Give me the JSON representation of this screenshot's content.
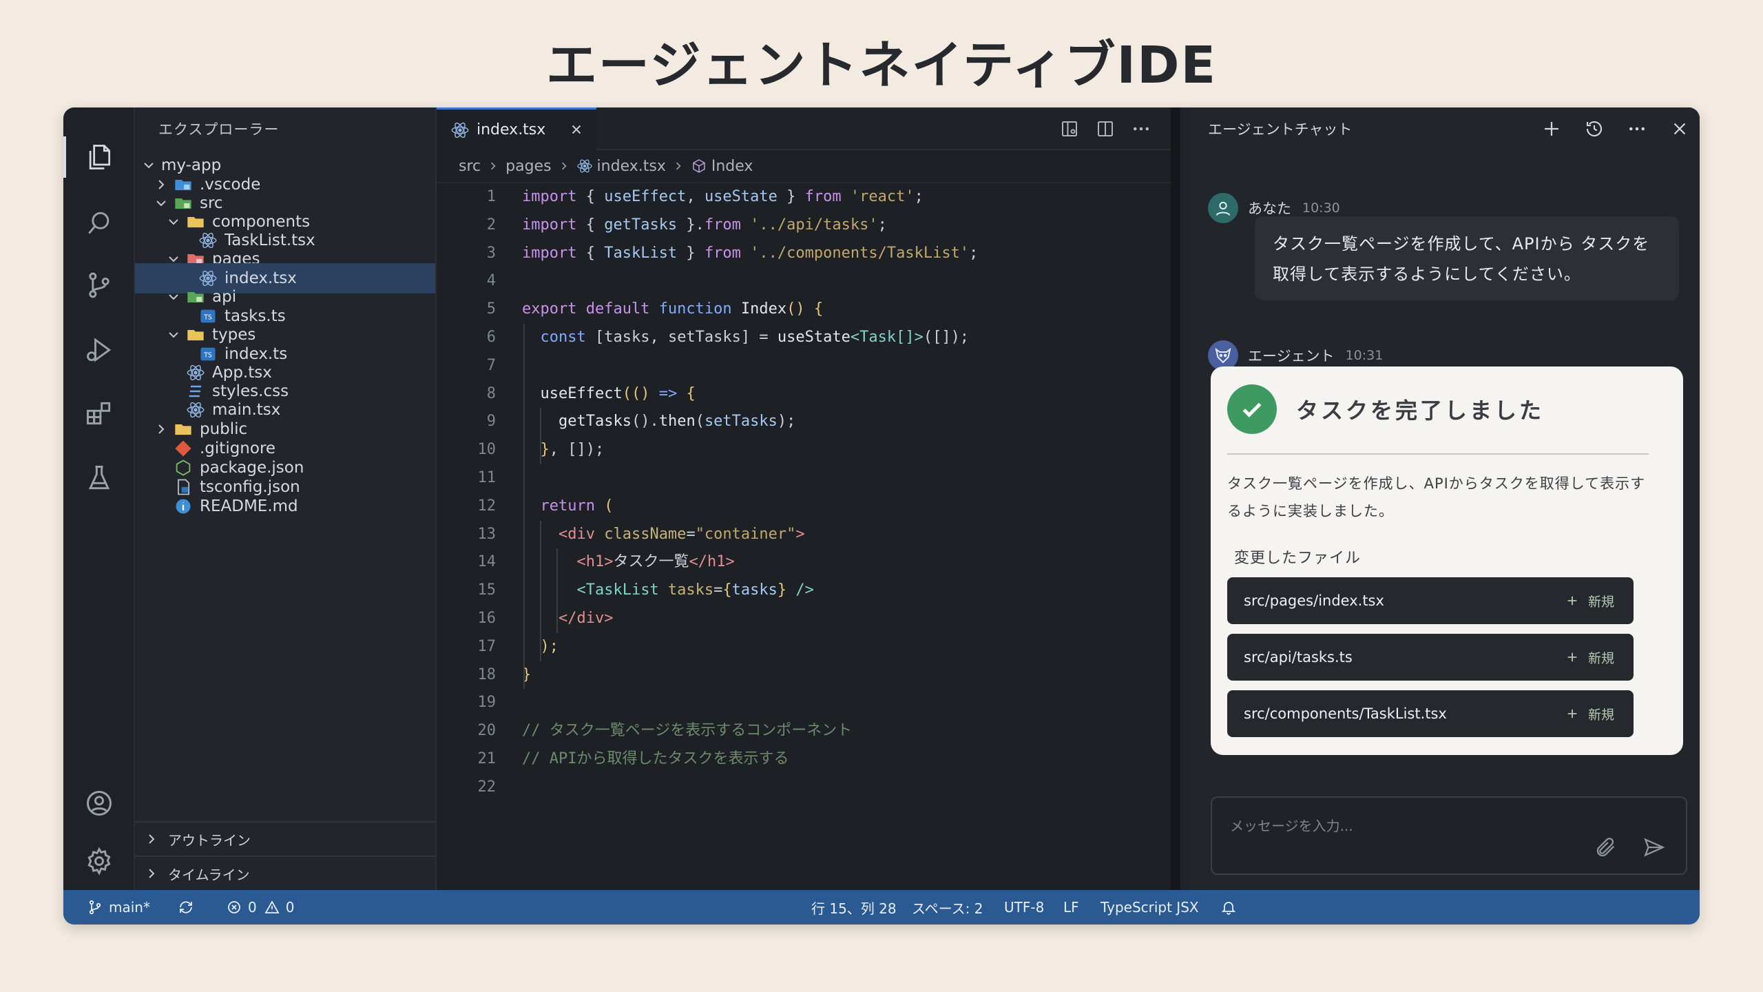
{
  "page": {
    "title": "エージェントネイティブIDE"
  },
  "explorer": {
    "header": "エクスプローラー",
    "tree": [
      {
        "label": "my-app",
        "depth": 0,
        "chevron": "down",
        "icon": "none"
      },
      {
        "label": ".vscode",
        "depth": 1,
        "chevron": "right",
        "icon": "folder-vscode"
      },
      {
        "label": "src",
        "depth": 1,
        "chevron": "down",
        "icon": "folder-src"
      },
      {
        "label": "components",
        "depth": 2,
        "chevron": "down",
        "icon": "folder"
      },
      {
        "label": "TaskList.tsx",
        "depth": 3,
        "chevron": "none",
        "icon": "react"
      },
      {
        "label": "pages",
        "depth": 2,
        "chevron": "down",
        "icon": "folder-pages"
      },
      {
        "label": "index.tsx",
        "depth": 3,
        "chevron": "none",
        "icon": "react",
        "selected": true
      },
      {
        "label": "api",
        "depth": 2,
        "chevron": "down",
        "icon": "folder-api"
      },
      {
        "label": "tasks.ts",
        "depth": 3,
        "chevron": "none",
        "icon": "ts"
      },
      {
        "label": "types",
        "depth": 2,
        "chevron": "down",
        "icon": "folder"
      },
      {
        "label": "index.ts",
        "depth": 3,
        "chevron": "none",
        "icon": "ts"
      },
      {
        "label": "App.tsx",
        "depth": 2,
        "chevron": "none",
        "icon": "react"
      },
      {
        "label": "styles.css",
        "depth": 2,
        "chevron": "none",
        "icon": "css"
      },
      {
        "label": "main.tsx",
        "depth": 2,
        "chevron": "none",
        "icon": "react"
      },
      {
        "label": "public",
        "depth": 1,
        "chevron": "right",
        "icon": "folder"
      },
      {
        "label": ".gitignore",
        "depth": 1,
        "chevron": "none",
        "icon": "git"
      },
      {
        "label": "package.json",
        "depth": 1,
        "chevron": "none",
        "icon": "node"
      },
      {
        "label": "tsconfig.json",
        "depth": 1,
        "chevron": "none",
        "icon": "tsconfig"
      },
      {
        "label": "README.md",
        "depth": 1,
        "chevron": "none",
        "icon": "info"
      }
    ],
    "sections": [
      "アウトライン",
      "タイムライン"
    ]
  },
  "editor": {
    "tab_label": "index.tsx",
    "breadcrumb": [
      "src",
      "pages",
      "index.tsx",
      "Index"
    ],
    "lines": [
      [
        [
          "k",
          "import "
        ],
        [
          "p",
          "{ "
        ],
        [
          "v",
          "useEffect"
        ],
        [
          "p",
          ", "
        ],
        [
          "v",
          "useState"
        ],
        [
          "p",
          " } "
        ],
        [
          "k",
          "from "
        ],
        [
          "s",
          "'react'"
        ],
        [
          "p",
          ";"
        ]
      ],
      [
        [
          "k",
          "import "
        ],
        [
          "p",
          "{ "
        ],
        [
          "v",
          "getTasks"
        ],
        [
          "p",
          " }."
        ],
        [
          "k",
          "from "
        ],
        [
          "s",
          "'../api/tasks'"
        ],
        [
          "p",
          ";"
        ]
      ],
      [
        [
          "k",
          "import "
        ],
        [
          "p",
          "{ "
        ],
        [
          "v",
          "TaskList"
        ],
        [
          "p",
          " } "
        ],
        [
          "k",
          "from "
        ],
        [
          "s",
          "'../components/TaskList'"
        ],
        [
          "p",
          ";"
        ]
      ],
      [],
      [
        [
          "k",
          "export default "
        ],
        [
          "kw",
          "function "
        ],
        [
          "f",
          "Index"
        ],
        [
          "br",
          "() {"
        ]
      ],
      [
        [
          "p",
          "  "
        ],
        [
          "kw",
          "const "
        ],
        [
          "p",
          "[tasks, setTasks] = "
        ],
        [
          "f",
          "useState"
        ],
        [
          "t",
          "<Task[]>"
        ],
        [
          "p",
          "([]);"
        ]
      ],
      [],
      [
        [
          "p",
          "  "
        ],
        [
          "f",
          "useEffect"
        ],
        [
          "br",
          "(() "
        ],
        [
          "kw",
          "=> "
        ],
        [
          "br",
          "{"
        ]
      ],
      [
        [
          "p",
          "    "
        ],
        [
          "f",
          "getTasks"
        ],
        [
          "p",
          "()."
        ],
        [
          "f",
          "then"
        ],
        [
          "p",
          "("
        ],
        [
          "v",
          "setTasks"
        ],
        [
          "p",
          ");"
        ]
      ],
      [
        [
          "p",
          "  "
        ],
        [
          "br",
          "}"
        ],
        [
          "p",
          ", []);"
        ]
      ],
      [],
      [
        [
          "p",
          "  "
        ],
        [
          "k",
          "return "
        ],
        [
          "br",
          "("
        ]
      ],
      [
        [
          "p",
          "    "
        ],
        [
          "tag",
          "<div "
        ],
        [
          "attr",
          "className"
        ],
        [
          "p",
          "="
        ],
        [
          "s",
          "\"container\""
        ],
        [
          "tag",
          ">"
        ]
      ],
      [
        [
          "p",
          "      "
        ],
        [
          "tag",
          "<h1>"
        ],
        [
          "p",
          "タスク一覧"
        ],
        [
          "tag",
          "</h1>"
        ]
      ],
      [
        [
          "p",
          "      "
        ],
        [
          "t",
          "<TaskList "
        ],
        [
          "attr",
          "tasks"
        ],
        [
          "p",
          "="
        ],
        [
          "br",
          "{"
        ],
        [
          "v",
          "tasks"
        ],
        [
          "br",
          "}"
        ],
        [
          "t",
          " />"
        ]
      ],
      [
        [
          "p",
          "    "
        ],
        [
          "tag",
          "</div>"
        ]
      ],
      [
        [
          "p",
          "  "
        ],
        [
          "br",
          ");"
        ]
      ],
      [
        [
          "br",
          "}"
        ]
      ],
      [],
      [
        [
          "cm",
          "// タスク一覧ページを表示するコンポーネント"
        ]
      ],
      [
        [
          "cm",
          "// APIから取得したタスクを表示する"
        ]
      ],
      []
    ]
  },
  "chat": {
    "title": "エージェントチャット",
    "user": {
      "name": "あなた",
      "time": "10:30",
      "text": "タスク一覧ページを作成して、APIから タスクを取得して表示するようにしてください。"
    },
    "agent": {
      "name": "エージェント",
      "time": "10:31"
    },
    "card": {
      "title": "タスクを完了しました",
      "body": "タスク一覧ページを作成し、APIからタスクを取得して表示するように実装しました。",
      "files_label": "変更したファイル",
      "files": [
        {
          "path": "src/pages/index.tsx",
          "badge": "新規"
        },
        {
          "path": "src/api/tasks.ts",
          "badge": "新規"
        },
        {
          "path": "src/components/TaskList.tsx",
          "badge": "新規"
        }
      ]
    },
    "input_placeholder": "メッセージを入力..."
  },
  "statusbar": {
    "branch": "main*",
    "errors": "0",
    "warnings": "0",
    "position": "行 15、列 28",
    "spaces": "スペース: 2",
    "encoding": "UTF-8",
    "eol": "LF",
    "language": "TypeScript JSX"
  },
  "colors": {
    "accent": "#3c7ac6",
    "statusbar": "#2b5a92",
    "success": "#3f9a62"
  }
}
